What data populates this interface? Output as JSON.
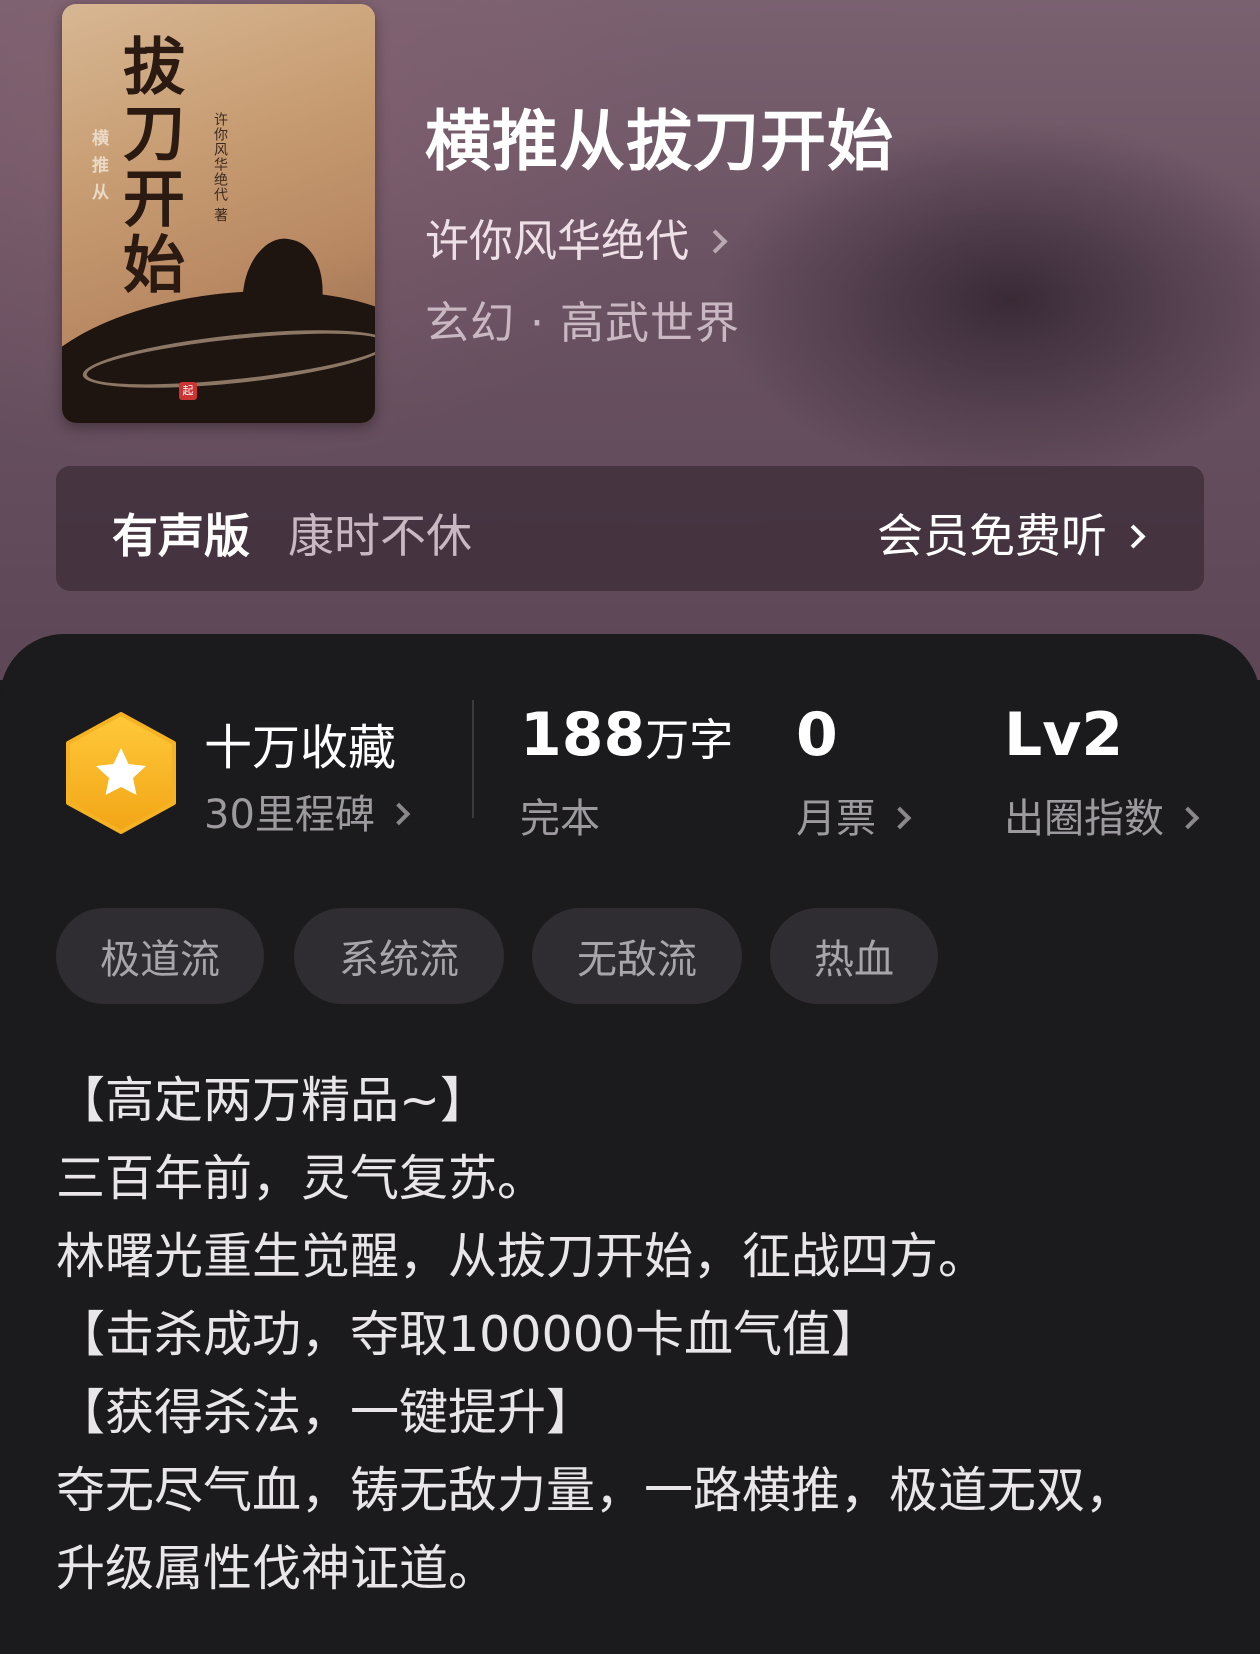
{
  "book": {
    "cover": {
      "big_title": "拔刀开始",
      "small_title": "横推从",
      "author": "许你风华绝代 著"
    },
    "title": "横推从拔刀开始",
    "author": "许你风华绝代",
    "genre": "玄幻 · 高武世界"
  },
  "audio": {
    "label": "有声版",
    "narrator": "康时不休",
    "cta": "会员免费听"
  },
  "stats": {
    "badge_icon": "star-hexagon-icon",
    "favorites": "十万收藏",
    "milestone": "30里程碑",
    "word_count": "188",
    "word_unit": "万字",
    "status": "完本",
    "monthly_tickets": "0",
    "monthly_tickets_label": "月票",
    "index_value": "Lv2",
    "index_label": "出圈指数"
  },
  "tags": [
    "极道流",
    "系统流",
    "无敌流",
    "热血"
  ],
  "description": [
    "【高定两万精品~】",
    "三百年前，灵气复苏。",
    "林曙光重生觉醒，从拔刀开始，征战四方。",
    "【击杀成功，夺取100000卡血气值】",
    "【获得杀法，一键提升】",
    "夺无尽气血，铸无敌力量，一路横推，极道无双，",
    "升级属性伐神证道。"
  ],
  "colors": {
    "hero_bg": "#6a5262",
    "panel_bg": "#1b1a1c",
    "badge": "#f5b323",
    "tag_bg": "#2f2d31"
  }
}
